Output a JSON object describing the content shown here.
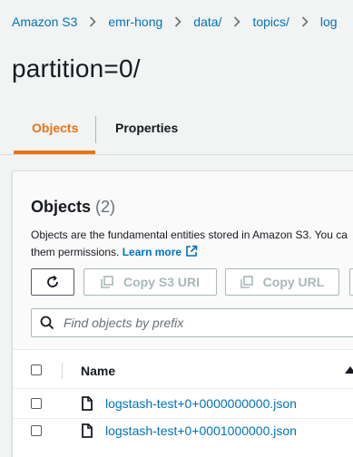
{
  "breadcrumb": {
    "items": [
      "Amazon S3",
      "emr-hong",
      "data/",
      "topics/",
      "log"
    ]
  },
  "page": {
    "title": "partition=0/"
  },
  "tabs": [
    {
      "label": "Objects",
      "active": true
    },
    {
      "label": "Properties",
      "active": false
    }
  ],
  "panel": {
    "title": "Objects",
    "count": "(2)",
    "description": "Objects are the fundamental entities stored in Amazon S3. You ca",
    "description_line2": "them permissions.",
    "learn_more": "Learn more",
    "buttons": {
      "refresh_icon": "refresh-icon",
      "copy_s3_uri": "Copy S3 URI",
      "copy_url": "Copy URL"
    },
    "search": {
      "placeholder": "Find objects by prefix",
      "value": ""
    },
    "table": {
      "columns": [
        "Name"
      ],
      "rows": [
        {
          "name": "logstash-test+0+0000000000.json",
          "icon": "file-icon"
        },
        {
          "name": "logstash-test+0+0001000000.json",
          "icon": "file-icon"
        }
      ]
    }
  },
  "colors": {
    "link": "#0073bb",
    "accent": "#ec7211",
    "text": "#16191f",
    "muted": "#687078",
    "disabled": "#aab7b8",
    "background": "#f2f3f3"
  }
}
